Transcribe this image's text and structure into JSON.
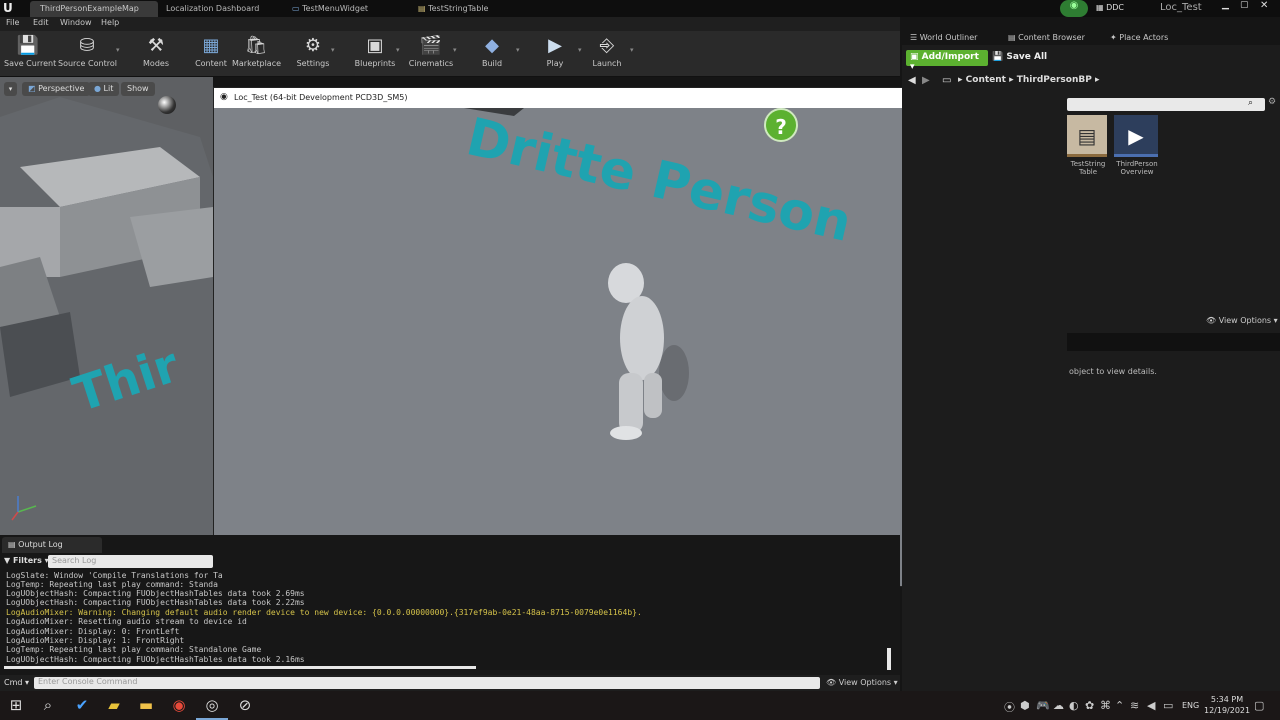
{
  "tabs": [
    {
      "label": "ThirdPersonExampleMap"
    },
    {
      "label": "Localization Dashboard"
    },
    {
      "label": "TestMenuWidget"
    },
    {
      "label": "TestStringTable"
    }
  ],
  "topright": {
    "ddc": "DDC",
    "project": "Loc_Test"
  },
  "menu": [
    "File",
    "Edit",
    "Window",
    "Help"
  ],
  "toolbar": [
    {
      "label": "Save Current",
      "icon": "save-icon"
    },
    {
      "label": "Source Control",
      "icon": "source-control-icon"
    },
    {
      "label": "Modes",
      "icon": "modes-icon"
    },
    {
      "label": "Content",
      "icon": "content-icon"
    },
    {
      "label": "Marketplace",
      "icon": "marketplace-icon"
    },
    {
      "label": "Settings",
      "icon": "settings-icon"
    },
    {
      "label": "Blueprints",
      "icon": "blueprints-icon"
    },
    {
      "label": "Cinematics",
      "icon": "cinematics-icon"
    },
    {
      "label": "Build",
      "icon": "build-icon"
    },
    {
      "label": "Play",
      "icon": "play-icon"
    },
    {
      "label": "Launch",
      "icon": "launch-icon"
    }
  ],
  "viewport": {
    "perspective": "Perspective",
    "lit": "Lit",
    "show": "Show",
    "floor_text": "Thir"
  },
  "game_window": {
    "title": "Loc_Test (64-bit Development PCD3D_SM5)",
    "floor_text": "Dritte Person"
  },
  "right_panel": {
    "tabs": [
      "World Outliner",
      "Content Browser",
      "Place Actors"
    ],
    "add_import": "Add/Import",
    "save_all": "Save All",
    "path": [
      "Content",
      "ThirdPersonBP"
    ],
    "assets": [
      {
        "label": "TestString Table"
      },
      {
        "label": "ThirdPerson Overview"
      }
    ],
    "view_options": "View Options",
    "details_hint": "object to view details."
  },
  "output_log": {
    "tab": "Output Log",
    "filters": "Filters",
    "search_placeholder": "Search Log",
    "lines": [
      {
        "text": "LogSlate: Window 'Compile Translations for Ta",
        "warn": false
      },
      {
        "text": "LogTemp: Repeating last play command: Standa",
        "warn": false
      },
      {
        "text": "LogUObjectHash: Compacting FUObjectHashTables data took   2.69ms",
        "warn": false
      },
      {
        "text": "LogUObjectHash: Compacting FUObjectHashTables data took   2.22ms",
        "warn": false
      },
      {
        "text": "LogAudioMixer: Warning: Changing default audio render device to new device: {0.0.0.00000000}.{317ef9ab-0e21-48aa-8715-0079e0e1164b}.",
        "warn": true
      },
      {
        "text": "LogAudioMixer: Resetting audio stream to device id",
        "warn": false
      },
      {
        "text": "LogAudioMixer: Display: 0: FrontLeft",
        "warn": false
      },
      {
        "text": "LogAudioMixer: Display: 1: FrontRight",
        "warn": false
      },
      {
        "text": "LogTemp: Repeating last play command: Standalone Game",
        "warn": false
      },
      {
        "text": "LogUObjectHash: Compacting FUObjectHashTables data took   2.16ms",
        "warn": false
      }
    ],
    "cmd_label": "Cmd",
    "cmd_placeholder": "Enter Console Command",
    "view_options": "View Options"
  },
  "taskbar": {
    "lang": "ENG",
    "time": "5:34 PM",
    "date": "12/19/2021"
  },
  "colors": {
    "accent_green": "#5cb130",
    "floor_text": "#1fa3b0"
  }
}
